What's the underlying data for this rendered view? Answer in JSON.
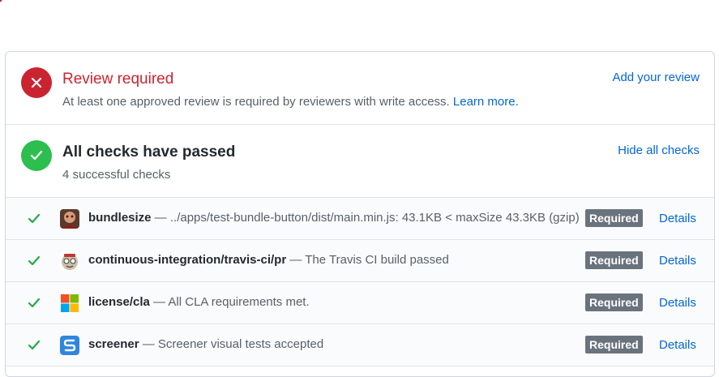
{
  "review": {
    "title": "Review required",
    "subtitle": "At least one approved review is required by reviewers with write access.",
    "learn_more": "Learn more.",
    "action": "Add your review"
  },
  "checks": {
    "title": "All checks have passed",
    "subtitle": "4 successful checks",
    "action": "Hide all checks",
    "items": [
      {
        "name": "bundlesize",
        "description": "../apps/test-bundle-button/dist/main.min.js: 43.1KB < maxSize 43.3KB (gzip)",
        "badge": "Required",
        "details": "Details",
        "avatar_icon": "bundlesize-avatar-icon"
      },
      {
        "name": "continuous-integration/travis-ci/pr",
        "description": "The Travis CI build passed",
        "badge": "Required",
        "details": "Details",
        "avatar_icon": "travis-ci-icon"
      },
      {
        "name": "license/cla",
        "description": "All CLA requirements met.",
        "badge": "Required",
        "details": "Details",
        "avatar_icon": "microsoft-icon"
      },
      {
        "name": "screener",
        "description": "Screener visual tests accepted",
        "badge": "Required",
        "details": "Details",
        "avatar_icon": "screener-icon"
      }
    ]
  },
  "colors": {
    "fail": "#cb2431",
    "success": "#2cbe4e",
    "link": "#0366d6",
    "badge": "#6a737d"
  }
}
